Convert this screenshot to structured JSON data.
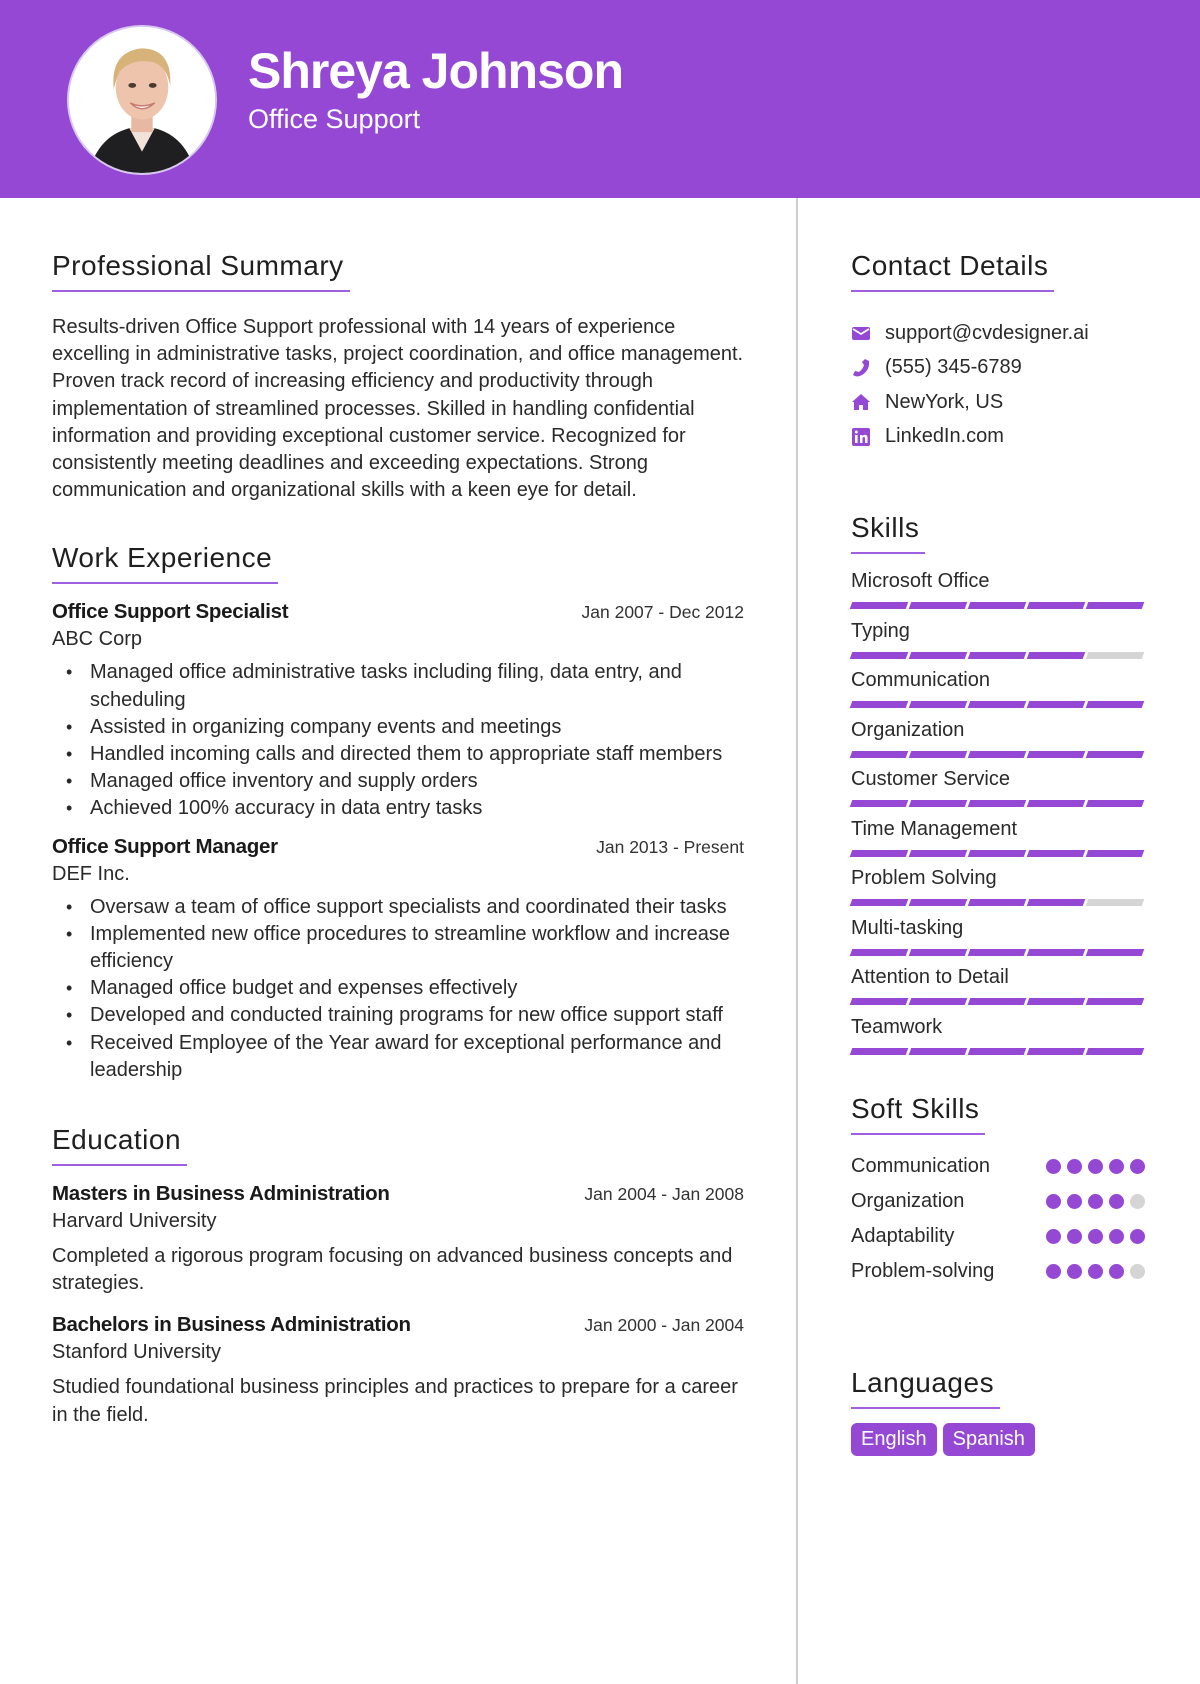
{
  "header": {
    "name": "Shreya Johnson",
    "title": "Office Support",
    "photo_alt": "profile-photo"
  },
  "colors": {
    "accent": "#9448d4",
    "inactive": "#d5d5d5",
    "divider": "#cfcfcf"
  },
  "summary": {
    "heading": "Professional Summary",
    "text": "Results-driven Office Support professional with 14 years of experience excelling in administrative tasks, project coordination, and office management. Proven track record of increasing efficiency and productivity through implementation of streamlined processes. Skilled in handling confidential information and providing exceptional customer service. Recognized for consistently meeting deadlines and exceeding expectations. Strong communication and organizational skills with a keen eye for detail."
  },
  "experience": {
    "heading": "Work Experience",
    "jobs": [
      {
        "title": "Office Support Specialist",
        "dates": "Jan 2007 - Dec 2012",
        "company": "ABC Corp",
        "bullets": [
          "Managed office administrative tasks including filing, data entry, and scheduling",
          "Assisted in organizing company events and meetings",
          "Handled incoming calls and directed them to appropriate staff members",
          "Managed office inventory and supply orders",
          "Achieved 100% accuracy in data entry tasks"
        ]
      },
      {
        "title": "Office Support Manager",
        "dates": "Jan 2013 - Present",
        "company": "DEF Inc.",
        "bullets": [
          "Oversaw a team of office support specialists and coordinated their tasks",
          "Implemented new office procedures to streamline workflow and increase efficiency",
          "Managed office budget and expenses effectively",
          "Developed and conducted training programs for new office support staff",
          "Received Employee of the Year award for exceptional performance and leadership"
        ]
      }
    ]
  },
  "education": {
    "heading": "Education",
    "items": [
      {
        "degree": "Masters in Business Administration",
        "dates": "Jan 2004 - Jan 2008",
        "school": "Harvard University",
        "description": "Completed a rigorous program focusing on advanced business concepts and strategies."
      },
      {
        "degree": "Bachelors in Business Administration",
        "dates": "Jan 2000 - Jan 2004",
        "school": "Stanford University",
        "description": "Studied foundational business principles and practices to prepare for a career in the field."
      }
    ]
  },
  "contact": {
    "heading": "Contact Details",
    "items": [
      {
        "icon": "envelope-icon",
        "text": "support@cvdesigner.ai"
      },
      {
        "icon": "phone-icon",
        "text": "(555) 345-6789"
      },
      {
        "icon": "home-icon",
        "text": "NewYork, US"
      },
      {
        "icon": "linkedin-icon",
        "text": "LinkedIn.com"
      }
    ]
  },
  "skills": {
    "heading": "Skills",
    "max": 5,
    "items": [
      {
        "name": "Microsoft Office",
        "level": 5
      },
      {
        "name": "Typing",
        "level": 4
      },
      {
        "name": "Communication",
        "level": 5
      },
      {
        "name": "Organization",
        "level": 5
      },
      {
        "name": "Customer Service",
        "level": 5
      },
      {
        "name": "Time Management",
        "level": 5
      },
      {
        "name": "Problem Solving",
        "level": 4
      },
      {
        "name": "Multi-tasking",
        "level": 5
      },
      {
        "name": "Attention to Detail",
        "level": 5
      },
      {
        "name": "Teamwork",
        "level": 5
      }
    ]
  },
  "soft_skills": {
    "heading": "Soft Skills",
    "max": 5,
    "items": [
      {
        "name": "Communication",
        "level": 5
      },
      {
        "name": "Organization",
        "level": 4
      },
      {
        "name": "Adaptability",
        "level": 5
      },
      {
        "name": "Problem-solving",
        "level": 4
      }
    ]
  },
  "languages": {
    "heading": "Languages",
    "items": [
      "English",
      "Spanish"
    ]
  }
}
